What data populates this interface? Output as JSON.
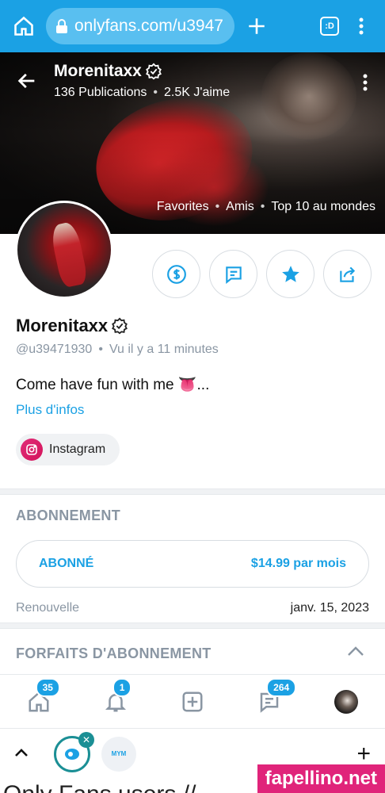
{
  "browser": {
    "url": "onlyfans.com/u3947",
    "tab_label": ":D"
  },
  "cover": {
    "name": "Morenitaxx",
    "publications": "136 Publications",
    "likes": "2.5K J'aime",
    "badges": [
      "Favorites",
      "Amis",
      "Top 10 au mondes"
    ]
  },
  "profile": {
    "name": "Morenitaxx",
    "handle": "@u39471930",
    "last_seen": "Vu il y a 11 minutes",
    "bio": "Come have fun with me 👅...",
    "more_info": "Plus d'infos",
    "instagram_label": "Instagram"
  },
  "subscription": {
    "section_title": "ABONNEMENT",
    "status": "ABONNÉ",
    "price": "$14.99 par mois",
    "renew_label": "Renouvelle",
    "renew_date": "janv. 15, 2023"
  },
  "bundles": {
    "section_title": "FORFAITS D'ABONNEMENT"
  },
  "nav": {
    "home_count": "35",
    "notif_count": "1",
    "messages_count": "264"
  },
  "toolbar": {
    "mym_label": "MYM"
  },
  "residual_text": "Only Fans users // ...",
  "watermark": "fapellino.net",
  "colors": {
    "brand": "#1ba1e4",
    "background": "#ffffff",
    "muted": "#8a96a3"
  }
}
